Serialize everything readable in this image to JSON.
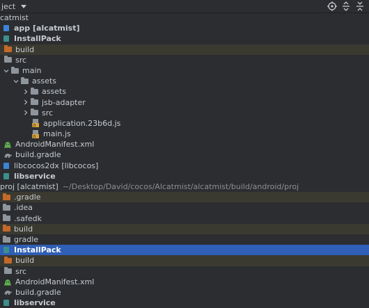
{
  "toolbar": {
    "title": "ject",
    "icons": [
      "locate-icon",
      "expand-all-icon",
      "collapse-all-icon"
    ]
  },
  "tree": [
    {
      "label": "catmist",
      "icon": "none",
      "arrow": "none"
    },
    {
      "label": "app [alcatmist]",
      "bold": true,
      "icon": "module-icon",
      "arrow": "none"
    },
    {
      "label": "InstallPack",
      "bold": true,
      "icon": "module-teal-icon",
      "arrow": "none"
    },
    {
      "label": "build",
      "icon": "folder-orange-icon",
      "arrow": "none",
      "excluded": true
    },
    {
      "label": "src",
      "icon": "folder-icon",
      "arrow": "none"
    },
    {
      "label": "main",
      "icon": "folder-icon",
      "arrow": "down"
    },
    {
      "label": "assets",
      "icon": "folder-icon",
      "arrow": "down"
    },
    {
      "label": "assets",
      "icon": "folder-icon",
      "arrow": "right"
    },
    {
      "label": "jsb-adapter",
      "icon": "folder-icon",
      "arrow": "right"
    },
    {
      "label": "src",
      "icon": "folder-icon",
      "arrow": "right"
    },
    {
      "label": "application.23b6d.js",
      "icon": "js-file-icon",
      "arrow": "none"
    },
    {
      "label": "main.js",
      "icon": "js-file-icon",
      "arrow": "none"
    },
    {
      "label": "AndroidManifest.xml",
      "icon": "manifest-icon",
      "arrow": "none"
    },
    {
      "label": "build.gradle",
      "icon": "gradle-icon",
      "arrow": "none"
    },
    {
      "label": "libcocos2dx [libcocos]",
      "icon": "module-icon",
      "arrow": "none"
    },
    {
      "label": "libservice",
      "bold": true,
      "icon": "module-teal-icon",
      "arrow": "none"
    },
    {
      "label": "proj [alcatmist]",
      "icon": "none",
      "arrow": "none",
      "path": "~/Desktop/David/cocos/Alcatmist/alcatmist/build/android/proj"
    },
    {
      "label": ".gradle",
      "icon": "folder-orange-icon",
      "arrow": "none",
      "excluded": true
    },
    {
      "label": ".idea",
      "icon": "folder-icon",
      "arrow": "none"
    },
    {
      "label": ".safedk",
      "icon": "folder-icon",
      "arrow": "none"
    },
    {
      "label": "build",
      "icon": "folder-orange-icon",
      "arrow": "none",
      "excluded": true
    },
    {
      "label": "gradle",
      "icon": "folder-icon",
      "arrow": "none"
    },
    {
      "label": "InstallPack",
      "bold": true,
      "icon": "module-teal-icon",
      "arrow": "none",
      "selected": true
    },
    {
      "label": "build",
      "icon": "folder-orange-icon",
      "arrow": "none",
      "excluded": true
    },
    {
      "label": "src",
      "icon": "folder-icon",
      "arrow": "none"
    },
    {
      "label": "AndroidManifest.xml",
      "icon": "manifest-icon",
      "arrow": "none"
    },
    {
      "label": "build.gradle",
      "icon": "gradle-icon",
      "arrow": "none"
    },
    {
      "label": "libservice",
      "bold": true,
      "icon": "module-teal-icon",
      "arrow": "none"
    }
  ],
  "colors": {
    "background": "#2b2d30",
    "selected": "#2f5fb6",
    "excluded": "#3b3a31",
    "folder": "#8f959c",
    "folder_excluded": "#c4692a",
    "path_text": "#8c8f94"
  }
}
